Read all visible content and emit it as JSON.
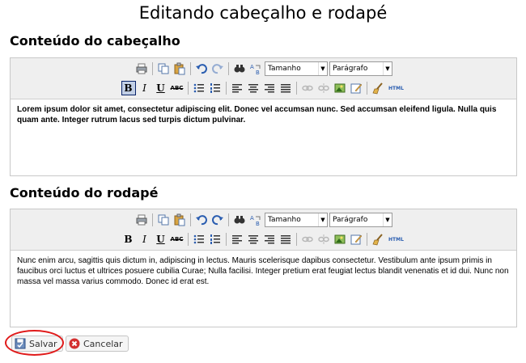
{
  "page": {
    "title": "Editando cabeçalho e rodapé"
  },
  "header_section": {
    "title": "Conteúdo do cabeçalho",
    "content": "Lorem ipsum dolor sit amet, consectetur adipiscing elit. Donec vel accumsan nunc. Sed accumsan eleifend ligula. Nulla quis quam ante. Integer rutrum lacus sed turpis dictum pulvinar."
  },
  "footer_section": {
    "title": "Conteúdo do rodapé",
    "content": "Nunc enim arcu, sagittis quis dictum in, adipiscing in lectus. Mauris scelerisque dapibus consectetur. Vestibulum ante ipsum primis in faucibus orci luctus et ultrices posuere cubilia Curae; Nulla facilisi. Integer pretium erat feugiat lectus blandit venenatis et id dui. Nunc non massa vel massa varius commodo. Donec id erat est."
  },
  "toolbar": {
    "size_select": "Tamanho",
    "format_select": "Parágrafo",
    "bold_label": "B",
    "italic_label": "I",
    "underline_label": "U",
    "strike_label": "ABC",
    "html_label": "HTML",
    "icons": [
      "print-icon",
      "copy-icon",
      "paste-icon",
      "undo-icon",
      "redo-icon",
      "find-icon",
      "replace-icon",
      "bold-icon",
      "italic-icon",
      "underline-icon",
      "strikethrough-icon",
      "bullet-list-icon",
      "numbered-list-icon",
      "align-left-icon",
      "align-center-icon",
      "align-right-icon",
      "align-justify-icon",
      "link-icon",
      "unlink-icon",
      "image-icon",
      "edit-icon",
      "cleanup-icon",
      "html-icon"
    ]
  },
  "actions": {
    "save_label": "Salvar",
    "cancel_label": "Cancelar"
  },
  "colors": {
    "highlight": "#e01a1a",
    "cancel_icon": "#d32f2f",
    "toolbar_bg": "#efefef"
  }
}
